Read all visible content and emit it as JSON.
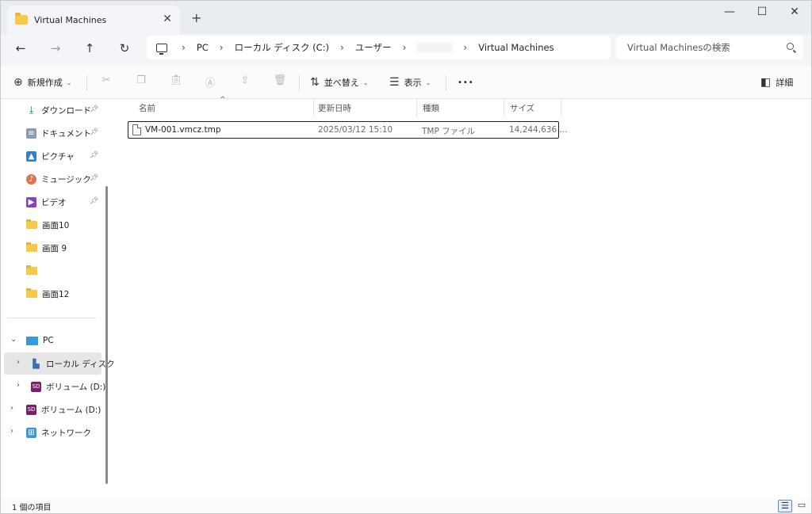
{
  "tab": {
    "title": "Virtual Machines"
  },
  "window_controls": {
    "minimize": "—",
    "maximize": "☐",
    "close": "✕"
  },
  "breadcrumb": [
    "PC",
    "ローカル ディスク (C:)",
    "ユーザー",
    "",
    "Virtual Machines"
  ],
  "search": {
    "placeholder": "Virtual Machinesの検索"
  },
  "toolbar": {
    "new_label": "新規作成",
    "sort_label": "並べ替え",
    "view_label": "表示",
    "more_label": "•••",
    "details_label": "詳細"
  },
  "sidebar": {
    "quick": [
      {
        "label": "ダウンロード",
        "icon": "download-icon"
      },
      {
        "label": "ドキュメント",
        "icon": "document-icon"
      },
      {
        "label": "ピクチャ",
        "icon": "picture-icon"
      },
      {
        "label": "ミュージック",
        "icon": "music-icon"
      },
      {
        "label": "ビデオ",
        "icon": "video-icon"
      }
    ],
    "folders": [
      "画面10",
      "画面 9",
      "",
      "画面12"
    ],
    "pc": "PC",
    "drives": [
      "ローカル ディスク",
      "ボリューム (D:)",
      "ボリューム (D:)"
    ],
    "network": "ネットワーク"
  },
  "columns": {
    "name": "名前",
    "date": "更新日時",
    "type": "種類",
    "size": "サイズ"
  },
  "files": [
    {
      "name": "VM-001.vmcz.tmp",
      "date": "2025/03/12 15:10",
      "type": "TMP ファイル",
      "size": "14,244,636 ..."
    }
  ],
  "status": {
    "count": "1 個の項目"
  }
}
